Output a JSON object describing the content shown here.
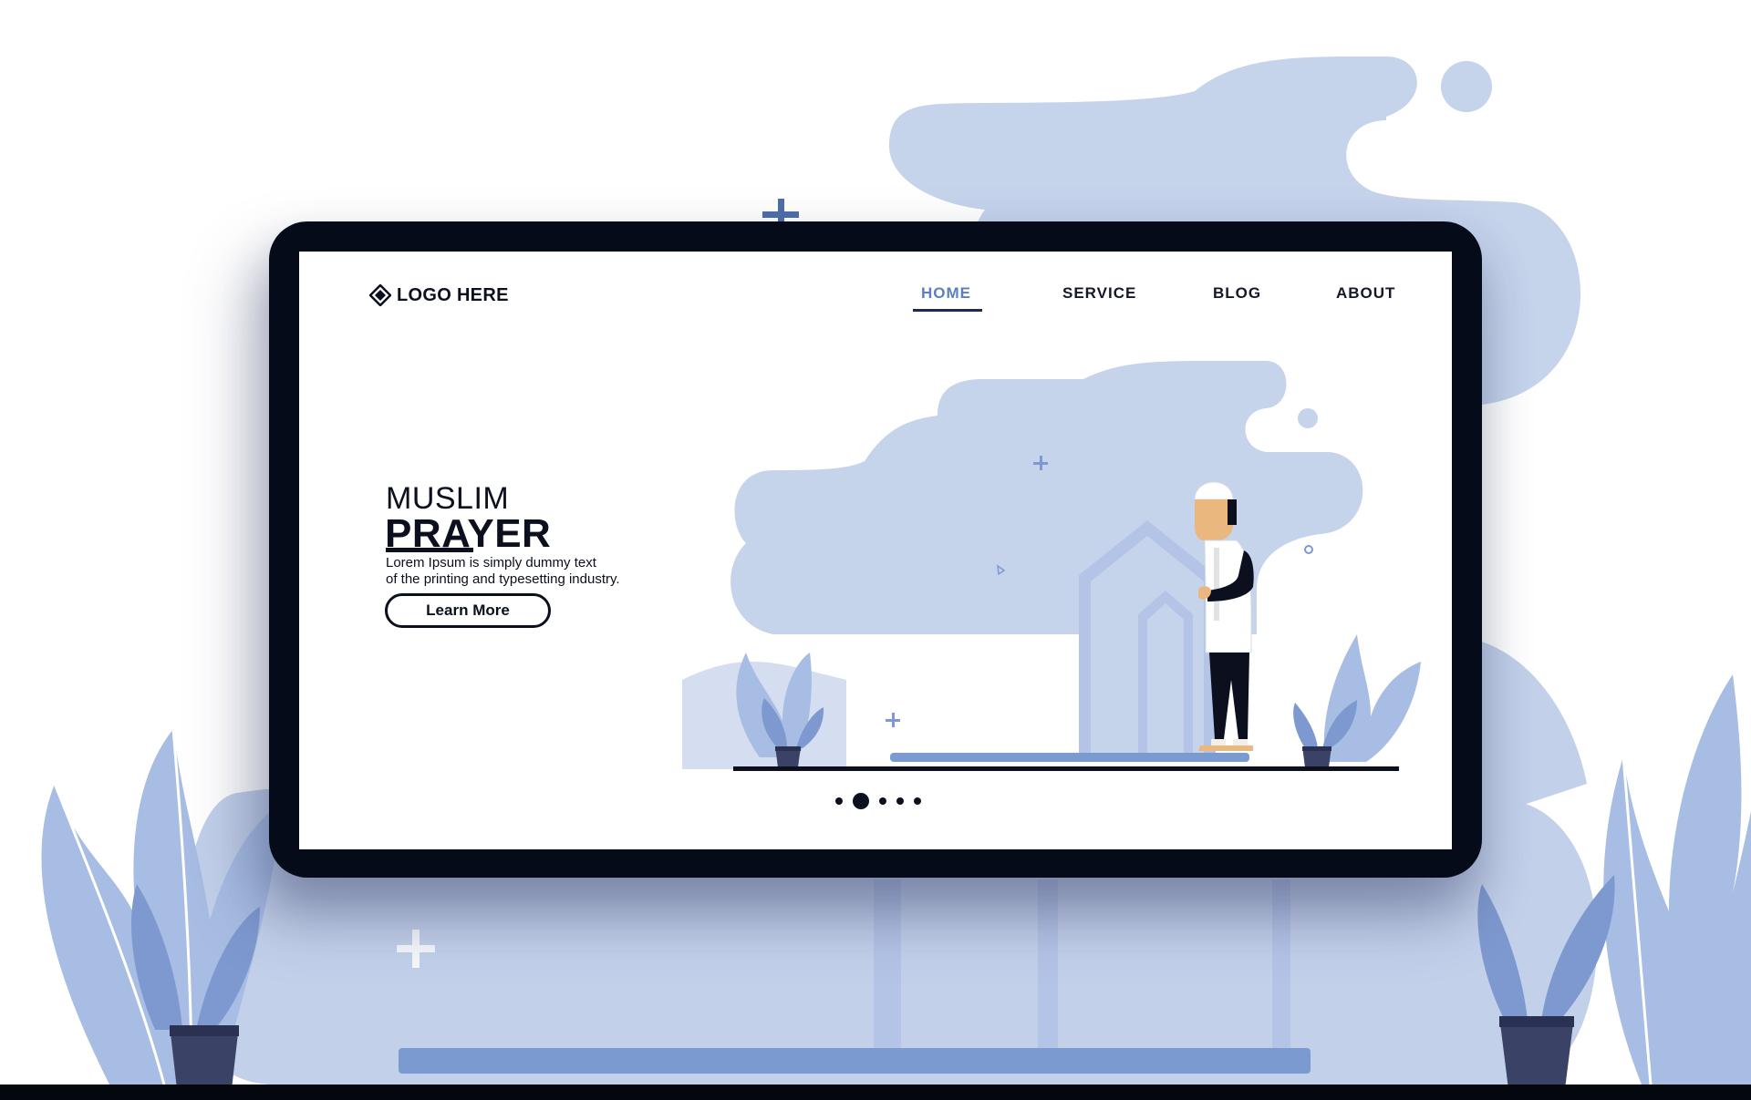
{
  "brand": {
    "logo_text": "LOGO HERE",
    "logo_icon": "diamond-logo-icon"
  },
  "nav": {
    "items": [
      {
        "label": "HOME",
        "active": true
      },
      {
        "label": "SERVICE",
        "active": false
      },
      {
        "label": "BLOG",
        "active": false
      },
      {
        "label": "ABOUT",
        "active": false
      }
    ]
  },
  "hero": {
    "title_line1": "MUSLIM",
    "title_line2": "PRAYER",
    "description_line1": "Lorem Ipsum is simply dummy text",
    "description_line2": "of the printing and typesetting industry.",
    "button_label": "Learn More"
  },
  "carousel": {
    "total": 5,
    "active_index": 1
  },
  "colors": {
    "accent": "#5b7fc0",
    "cloud": "#c5d3eb",
    "leaf": "#8ea7d6",
    "dark": "#060b1a"
  }
}
